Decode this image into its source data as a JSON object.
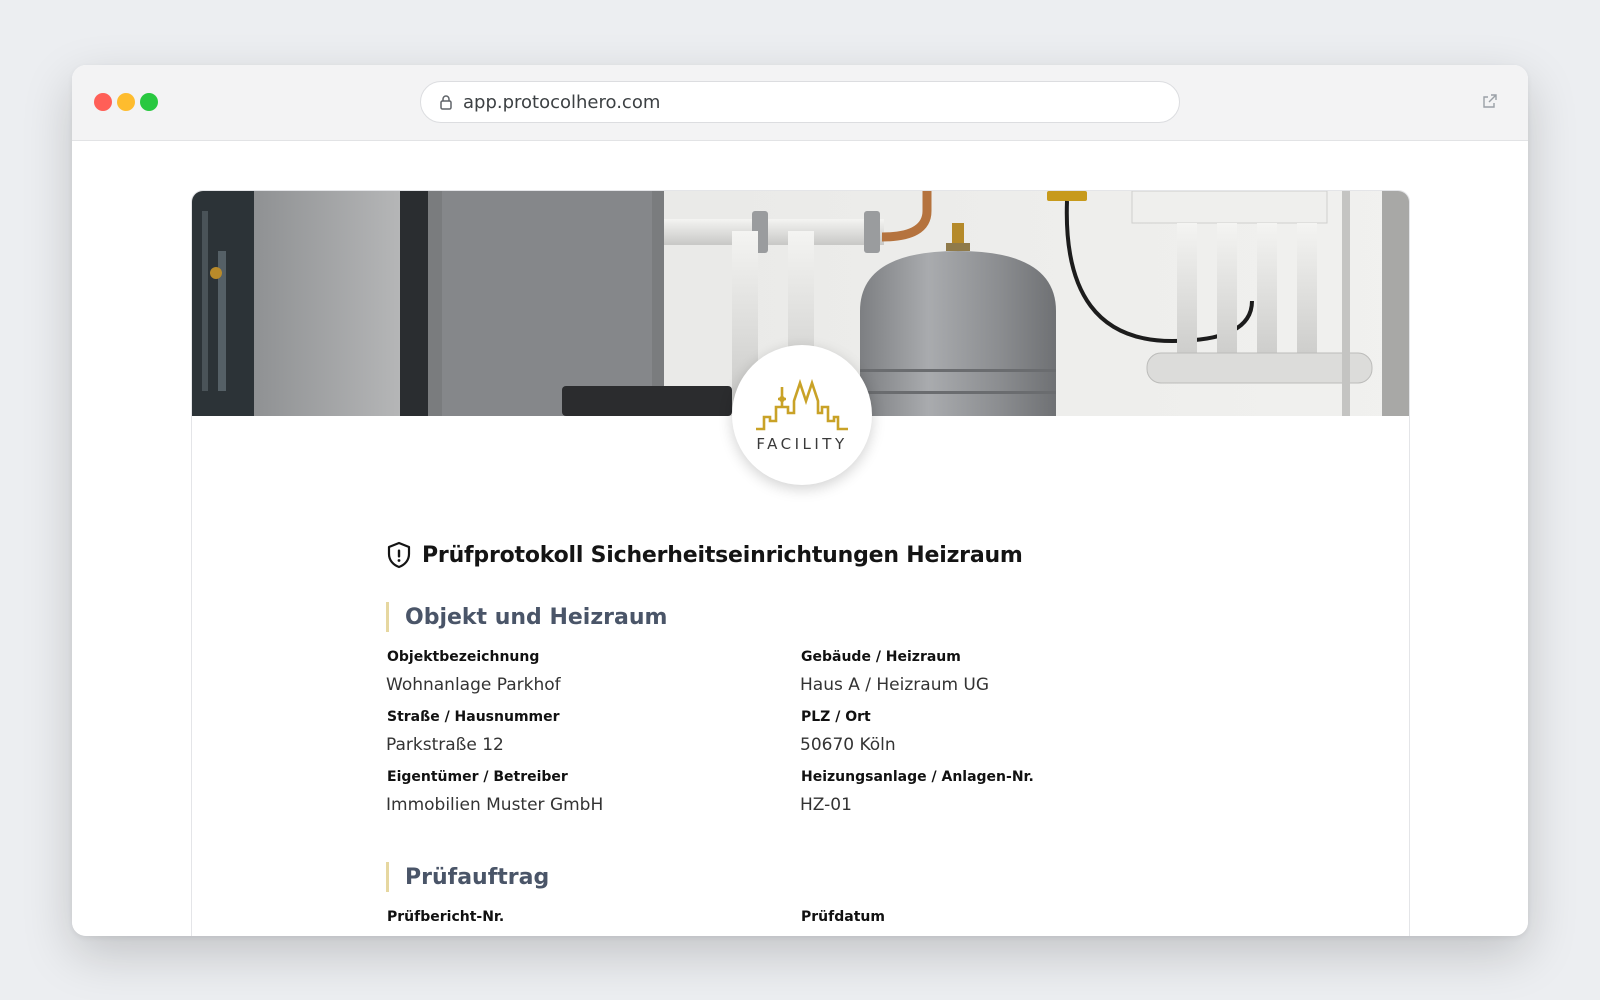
{
  "browser": {
    "url": "app.protocolhero.com",
    "colors": {
      "close": "#ff5f57",
      "minimize": "#febc2e",
      "maximize": "#28c840"
    }
  },
  "logo": {
    "word": "FACILITY",
    "color": "#c9a227"
  },
  "document": {
    "title": "Prüfprotokoll Sicherheitseinrichtungen Heizraum",
    "sections": [
      {
        "title": "Objekt und Heizraum",
        "fields": [
          {
            "label": "Objektbezeichnung",
            "value": "Wohnanlage Parkhof"
          },
          {
            "label": "Gebäude / Heizraum",
            "value": "Haus A / Heizraum UG"
          },
          {
            "label": "Straße / Hausnummer",
            "value": "Parkstraße 12"
          },
          {
            "label": "PLZ / Ort",
            "value": "50670 Köln"
          },
          {
            "label": "Eigentümer / Betreiber",
            "value": "Immobilien Muster GmbH"
          },
          {
            "label": "Heizungsanlage / Anlagen-Nr.",
            "value": "HZ-01"
          }
        ]
      },
      {
        "title": "Prüfauftrag",
        "fields": [
          {
            "label": "Prüfbericht-Nr.",
            "value": ""
          },
          {
            "label": "Prüfdatum",
            "value": ""
          }
        ]
      }
    ]
  }
}
